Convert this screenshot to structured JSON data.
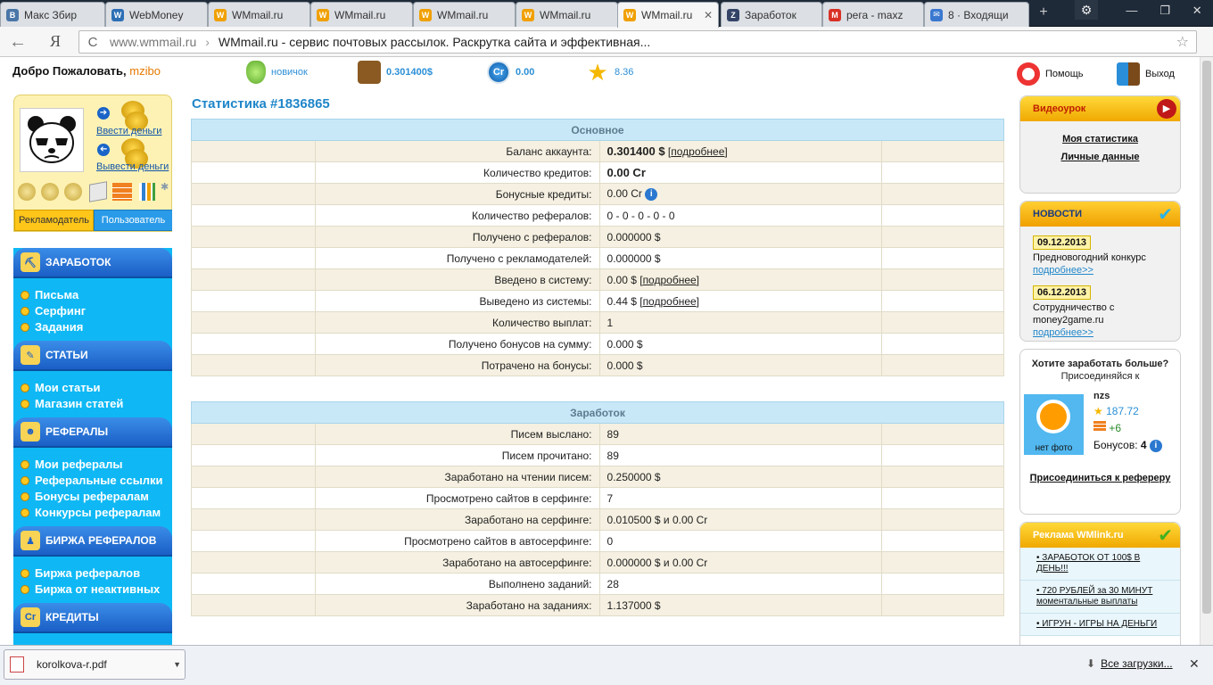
{
  "browser": {
    "tabs": [
      {
        "label": "Макс Збир",
        "fav": "В",
        "color": "#4a76a8"
      },
      {
        "label": "WebMoney",
        "fav": "W",
        "color": "#2d6fb5"
      },
      {
        "label": "WMmail.ru",
        "fav": "W",
        "color": "#f0a000"
      },
      {
        "label": "WMmail.ru",
        "fav": "W",
        "color": "#f0a000"
      },
      {
        "label": "WMmail.ru",
        "fav": "W",
        "color": "#f0a000"
      },
      {
        "label": "WMmail.ru",
        "fav": "W",
        "color": "#f0a000"
      },
      {
        "label": "WMmail.ru",
        "fav": "W",
        "color": "#f0a000"
      },
      {
        "label": "Заработок",
        "fav": "Z",
        "color": "#334466"
      },
      {
        "label": "рега - maxz",
        "fav": "M",
        "color": "#d93025"
      },
      {
        "label": "8 · Входящи",
        "fav": "✉",
        "color": "#3a78d0"
      }
    ],
    "active_tab_index": 6,
    "new_tab": "+",
    "back": "←",
    "logo": "Я",
    "url_host": "www.wmmail.ru",
    "url_sep": "›",
    "page_title": "WMmail.ru - сервис почтовых рассылок. Раскрутка сайта и эффективная...",
    "reload": "C",
    "star": "☆",
    "settings": "⚙"
  },
  "topbar": {
    "welcome": "Добро Пожаловать,",
    "username": "mzibo",
    "rank": "новичок",
    "balance": "0.301400$",
    "credits": "0.00",
    "rating": "8.36",
    "credits_icon": "Cr",
    "help": "Помощь",
    "exit": "Выход"
  },
  "profile": {
    "deposit": "Ввести деньги",
    "withdraw": "Вывести деньги",
    "role_adv": "Рекламодатель",
    "role_user": "Пользователь"
  },
  "menu": [
    {
      "title": "ЗАРАБОТОК",
      "items": [
        "Письма",
        "Серфинг",
        "Задания"
      ]
    },
    {
      "title": "СТАТЬИ",
      "items": [
        "Мои статьи",
        "Магазин статей"
      ]
    },
    {
      "title": "РЕФЕРАЛЫ",
      "items": [
        "Мои рефералы",
        "Реферальные ссылки",
        "Бонусы рефералам",
        "Конкурсы рефералам"
      ]
    },
    {
      "title": "БИРЖА РЕФЕРАЛОВ",
      "items": [
        "Биржа рефералов",
        "Биржа от неактивных"
      ]
    },
    {
      "title": "КРЕДИТЫ",
      "items": []
    }
  ],
  "main": {
    "title": "Статистика #1836865",
    "basic": {
      "header": "Основное",
      "rows": [
        {
          "label": "Баланс аккаунта:",
          "value": "0.301400 $",
          "link": "подробнее",
          "bold": true
        },
        {
          "label": "Количество кредитов:",
          "value": "0.00 Cr",
          "bold": true
        },
        {
          "label": "Бонусные кредиты:",
          "value": "0.00 Cr",
          "info": "i"
        },
        {
          "label": "Количество рефералов:",
          "value": "0 - 0 - 0 - 0 - 0"
        },
        {
          "label": "Получено с рефералов:",
          "value": "0.000000 $"
        },
        {
          "label": "Получено с рекламодателей:",
          "value": "0.000000 $"
        },
        {
          "label": "Введено в систему:",
          "value": "0.00 $",
          "link": "подробнее"
        },
        {
          "label": "Выведено из системы:",
          "value": "0.44 $",
          "link": "подробнее"
        },
        {
          "label": "Количество выплат:",
          "value": "1"
        },
        {
          "label": "Получено бонусов на сумму:",
          "value": "0.000 $"
        },
        {
          "label": "Потрачено на бонусы:",
          "value": "0.000 $"
        }
      ]
    },
    "earnings": {
      "header": "Заработок",
      "rows": [
        {
          "label": "Писем выслано:",
          "value": "89"
        },
        {
          "label": "Писем прочитано:",
          "value": "89"
        },
        {
          "label": "Заработано на чтении писем:",
          "value": "0.250000 $"
        },
        {
          "label": "Просмотрено сайтов в серфинге:",
          "value": "7"
        },
        {
          "label": "Заработано на серфинге:",
          "value": "0.010500 $ и 0.00 Cr"
        },
        {
          "label": "Просмотрено сайтов в автосерфинге:",
          "value": "0"
        },
        {
          "label": "Заработано на автосерфинге:",
          "value": "0.000000 $ и 0.00 Cr"
        },
        {
          "label": "Выполнено заданий:",
          "value": "28"
        },
        {
          "label": "Заработано на заданиях:",
          "value": "1.137000 $"
        }
      ]
    }
  },
  "right": {
    "video_title": "Видеоурок",
    "my_stats": "Моя статистика",
    "personal": "Личные данные",
    "news_title": "НОВОСТИ",
    "news": [
      {
        "date": "09.12.2013",
        "text": "Предновогодний конкурс",
        "more": "подробнее>>"
      },
      {
        "date": "06.12.2013",
        "text": "Сотрудничество с money2game.ru",
        "more": "подробнее>>"
      }
    ],
    "ref_head": "Хотите заработать больше?",
    "ref_sub": "Присоединяйся к",
    "ref_photo": "нет фото",
    "ref_name": "nzs",
    "ref_rating": "187.72",
    "ref_plus": "+6",
    "ref_bonus_label": "Бонусов:",
    "ref_bonus_value": "4",
    "ref_join": "Присоединиться к рефереру",
    "ads_title": "Реклама WMlink.ru",
    "ads": [
      "• ЗАРАБОТОК ОТ 100$ В ДЕНЬ!!!",
      "• 720 РУБЛЕЙ за 30 МИНУТ моментальные выплаты",
      "• ИГРУН - ИГРЫ НА ДЕНЬГИ"
    ]
  },
  "downloads": {
    "file": "korolkova-r.pdf",
    "all": "Все загрузки...",
    "close": "✕"
  }
}
